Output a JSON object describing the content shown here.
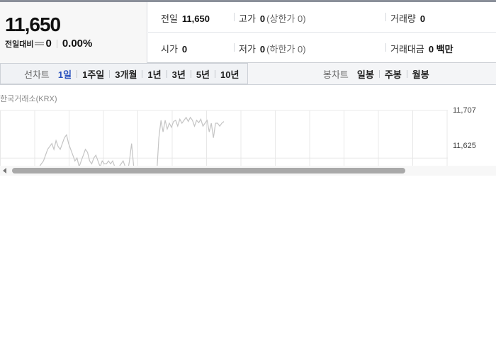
{
  "summary": {
    "price": "11,650",
    "change_label": "전일대비",
    "change_value": "0",
    "change_percent": "0.00%",
    "stats": {
      "prev_close": {
        "label": "전일",
        "value": "11,650"
      },
      "high": {
        "label": "고가",
        "value": "0",
        "sub": "(상한가 0)"
      },
      "volume": {
        "label": "거래량",
        "value": "0"
      },
      "open": {
        "label": "시가",
        "value": "0"
      },
      "low": {
        "label": "저가",
        "value": "0",
        "sub": "(하한가 0)"
      },
      "trade_value": {
        "label": "거래대금",
        "value": "0 백만"
      }
    }
  },
  "tabs": {
    "line_title": "선차트",
    "line_items": [
      "1일",
      "1주일",
      "3개월",
      "1년",
      "3년",
      "5년",
      "10년"
    ],
    "line_active": "1일",
    "candle_title": "봉차트",
    "candle_items": [
      "일봉",
      "주봉",
      "월봉"
    ]
  },
  "chart": {
    "source": "한국거래소(KRX)",
    "y_labels": [
      "11,707",
      "11,625"
    ],
    "colors": {
      "line": "#c4c4c4",
      "grid": "#e8e8e8"
    }
  },
  "chart_data": {
    "type": "line",
    "title": "",
    "xlabel": "",
    "ylabel": "",
    "ylim": [
      11585,
      11707
    ],
    "y_ticks": [
      11707,
      11625
    ],
    "series": [
      {
        "values": [
          11585,
          11585,
          11590,
          11586,
          11600,
          11586,
          11590,
          11595,
          11590,
          11588,
          11605,
          11600,
          11598,
          11604,
          11600,
          11605,
          11610,
          11615,
          11620,
          11630,
          11640,
          11645,
          11650,
          11640,
          11655,
          11645,
          11640,
          11650,
          11660,
          11665,
          11650,
          11640,
          11630,
          11620,
          11625,
          11610,
          11620,
          11630,
          11640,
          11635,
          11620,
          11615,
          11625,
          11630,
          11620,
          11610,
          11620,
          11615,
          11615,
          11620,
          11615,
          11620,
          11610,
          11600,
          11610,
          11615,
          11620,
          11610,
          11600,
          11620,
          11650,
          11610,
          11600,
          11590,
          11595,
          11600,
          11590,
          11592,
          11590,
          11588,
          11590,
          11600,
          11598,
          11660,
          11690,
          11670,
          11690,
          11675,
          11685,
          11678,
          11688,
          11690,
          11680,
          11692,
          11685,
          11690,
          11695,
          11688,
          11695,
          11690,
          11680,
          11690,
          11686,
          11692,
          11680,
          11685,
          11690,
          11670,
          11685,
          11660,
          11685,
          11685,
          11680,
          11685,
          11688
        ]
      }
    ]
  },
  "scrollbar": {
    "position": 0.02,
    "visible_fraction": 0.8
  }
}
